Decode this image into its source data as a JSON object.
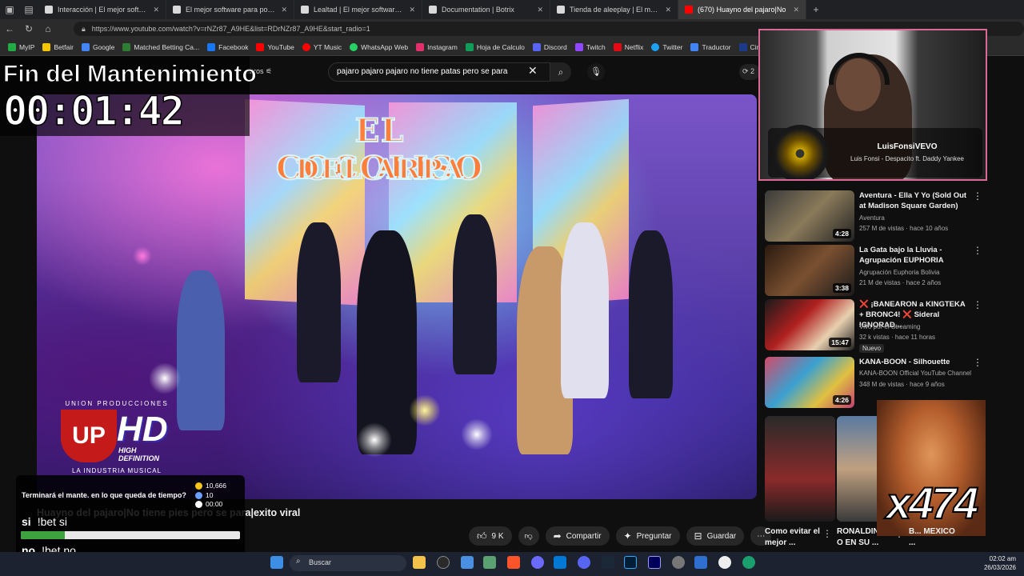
{
  "browser": {
    "tabs": [
      {
        "label": "Interacción | El mejor software pa",
        "active": false
      },
      {
        "label": "El mejor software para potenciar",
        "active": false
      },
      {
        "label": "Lealtad | El mejor software para p",
        "active": false
      },
      {
        "label": "Documentation | Botrix",
        "active": false
      },
      {
        "label": "Tienda de aleeplay | El mejor softw",
        "active": false
      },
      {
        "label": "(670) Huayno del pajaro|No",
        "active": true
      }
    ],
    "url": "https://www.youtube.com/watch?v=rNZr87_A9HE&list=RDrNZr87_A9HE&start_radio=1",
    "bookmarks": [
      {
        "label": "MyIP",
        "color": "#22aa44"
      },
      {
        "label": "Betfair",
        "color": "#f3c600"
      },
      {
        "label": "Google",
        "color": "#4285f4"
      },
      {
        "label": "Matched Betting Ca...",
        "color": "#2e7d32"
      },
      {
        "label": "Facebook",
        "color": "#1877f2"
      },
      {
        "label": "YouTube",
        "color": "#ff0000"
      },
      {
        "label": "YT Music",
        "color": "#ff0000"
      },
      {
        "label": "WhatsApp Web",
        "color": "#25d366"
      },
      {
        "label": "Instagram",
        "color": "#e1306c"
      },
      {
        "label": "Hoja de Calculo",
        "color": "#0f9d58"
      },
      {
        "label": "Discord",
        "color": "#5865f2"
      },
      {
        "label": "Twitch",
        "color": "#9146ff"
      },
      {
        "label": "Netflix",
        "color": "#e50914"
      },
      {
        "label": "Twitter",
        "color": "#1da1f2"
      },
      {
        "label": "Traductor",
        "color": "#4285f4"
      },
      {
        "label": "Cineplanet",
        "color": "#1b3b8a"
      }
    ]
  },
  "youtube": {
    "filters_label": "filtros",
    "search_query": "pajaro pajaro pajaro no tiene patas pero se para",
    "count_chip": "2",
    "video_banner": {
      "line1": "EL COCOLISO",
      "line2": "DEL ARPA"
    },
    "video_logo": {
      "top": "UNION PRODUCCIONES",
      "letters": "UP",
      "hd": "HD",
      "hd_sub": "HIGH DEFINITION",
      "bottom": "LA INDUSTRIA MUSICAL"
    },
    "video_title": "Huayno del pajaro|No tiene pies pero se para|exito viral",
    "actions": {
      "likes": "9 K",
      "share": "Compartir",
      "ask": "Preguntar",
      "save": "Guardar"
    },
    "recommendations": [
      {
        "title": "Aventura - Ella Y Yo (Sold Out at Madison Square Garden)",
        "channel": "Aventura",
        "stats": "257 M de vistas · hace 10 años",
        "duration": "4:28",
        "badge": ""
      },
      {
        "title": "La Gata bajo la Lluvia - Agrupación EUPHORIA",
        "channel": "Agrupación Euphoria Bolivia",
        "stats": "21 M de vistas · hace 2 años",
        "duration": "3:38",
        "badge": ""
      },
      {
        "title": "❌ ¡BANEARON a KINGTEKA + BRONC4! ❌ Sideral IGNORAD...",
        "channel": "Vivo por el Streaming",
        "stats": "32 k vistas · hace 11 horas",
        "duration": "15:47",
        "badge": "Nuevo"
      },
      {
        "title": "KANA-BOON - Silhouette",
        "channel": "KANA-BOON Official YouTube Channel",
        "stats": "348 M de vistas · hace 9 años",
        "duration": "4:26",
        "badge": ""
      }
    ],
    "shorts": [
      {
        "title": "Como evitar el mejor ..."
      },
      {
        "title": "RONALDIN O EN SU ..."
      },
      {
        "title": "B... MEXICO ..."
      }
    ]
  },
  "overlay": {
    "timer_title": "Fin del Mantenimiento",
    "timer_value": "00:01:42",
    "poll": {
      "question": "Terminará el mante. en lo que queda de tiempo?",
      "points": "10,666",
      "participants": "10",
      "time": "00:00",
      "options": [
        {
          "label": "si",
          "command": "!bet si",
          "fraction": 0.2
        },
        {
          "label": "no",
          "command": "!bet no",
          "fraction": 0.8
        }
      ]
    },
    "now_playing": {
      "artist": "LuisFonsiVEVO",
      "song": "Luis Fonsi - Despacito ft. Daddy Yankee"
    },
    "reaction_count": "x474"
  },
  "taskbar": {
    "search_label": "Buscar",
    "time": "02:02 am",
    "date": "26/03/2026"
  }
}
